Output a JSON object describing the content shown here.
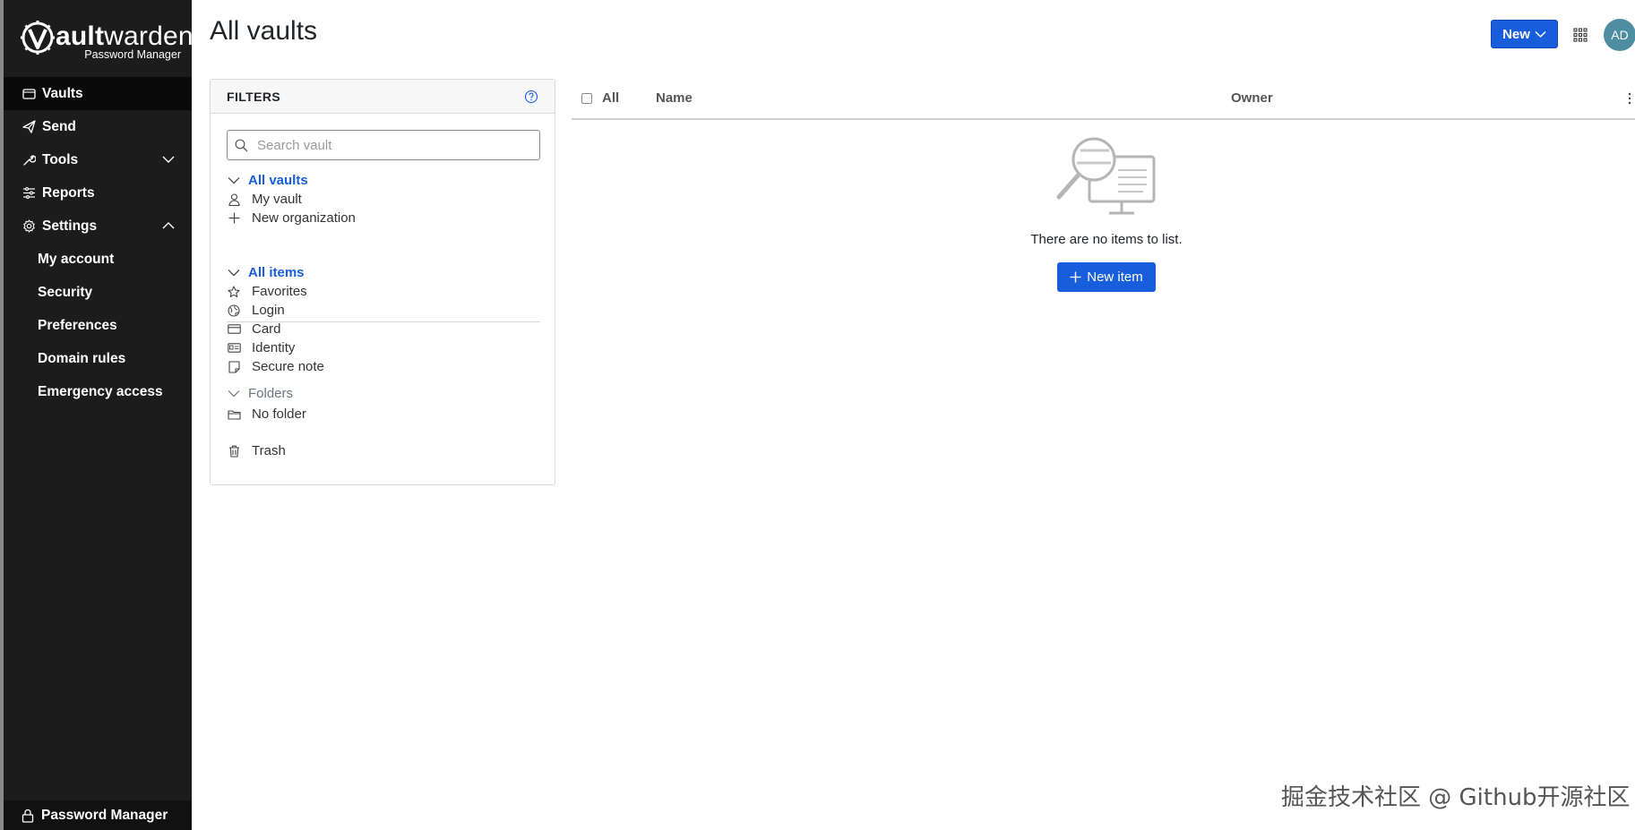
{
  "brand": {
    "word_prefix": "V",
    "word_bold": "ault",
    "word_rest": "warden",
    "subtitle": "Password Manager"
  },
  "sidebar": {
    "items": [
      {
        "label": "Vaults",
        "icon": "vault-icon",
        "active": true
      },
      {
        "label": "Send",
        "icon": "send-icon"
      },
      {
        "label": "Tools",
        "icon": "wrench-icon",
        "chevron": "chevron-down-icon"
      },
      {
        "label": "Reports",
        "icon": "sliders-icon"
      },
      {
        "label": "Settings",
        "icon": "gear-icon",
        "chevron": "chevron-up-icon"
      }
    ],
    "settings_sub": [
      "My account",
      "Security",
      "Preferences",
      "Domain rules",
      "Emergency access"
    ],
    "footer": {
      "label": "Password Manager",
      "icon": "lock-icon"
    }
  },
  "header": {
    "title": "All vaults",
    "new_button": "New",
    "avatar_initials": "AD"
  },
  "filters": {
    "title": "FILTERS",
    "search_placeholder": "Search vault",
    "vaults_heading": "All vaults",
    "vault_items": [
      {
        "label": "My vault",
        "icon": "user-icon"
      },
      {
        "label": "New organization",
        "icon": "plus-icon"
      }
    ],
    "items_heading": "All items",
    "type_items": [
      {
        "label": "Favorites",
        "icon": "star-icon"
      },
      {
        "label": "Login",
        "icon": "globe-icon"
      },
      {
        "label": "Card",
        "icon": "credit-card-icon"
      },
      {
        "label": "Identity",
        "icon": "id-card-icon"
      },
      {
        "label": "Secure note",
        "icon": "sticky-note-icon"
      }
    ],
    "folders_heading": "Folders",
    "folder_items": [
      {
        "label": "No folder",
        "icon": "folder-icon"
      }
    ],
    "trash": {
      "label": "Trash",
      "icon": "trash-icon"
    }
  },
  "table": {
    "columns": [
      "All",
      "Name",
      "Owner"
    ],
    "empty_text": "There are no items to list.",
    "new_item_button": "New item"
  },
  "watermark": "掘金技术社区 @ Github开源社区",
  "colors": {
    "primary": "#175ddc",
    "sidebar_bg": "#1c1c1c",
    "avatar_bg": "#4e8ea3"
  }
}
